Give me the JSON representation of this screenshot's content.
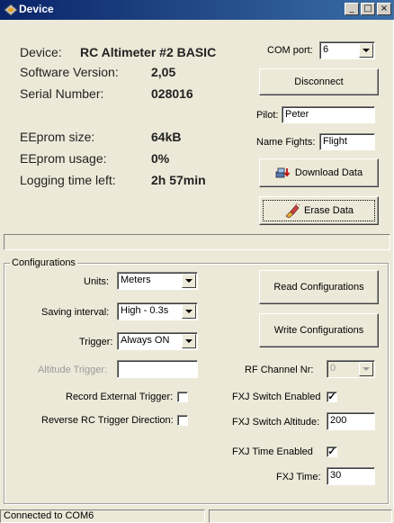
{
  "window": {
    "title": "Device",
    "min_glyph": "_",
    "max_glyph": "□",
    "close_glyph": "×"
  },
  "device": {
    "label": "Device:",
    "name": "RC Altimeter #2 BASIC",
    "software_label": "Software Version:",
    "software_value": "2,05",
    "serial_label": "Serial Number:",
    "serial_value": "028016",
    "eeprom_size_label": "EEprom size:",
    "eeprom_size_value": "64kB",
    "eeprom_usage_label": "EEprom usage:",
    "eeprom_usage_value": "0%",
    "logging_label": "Logging time left:",
    "logging_value": "2h  57min"
  },
  "right_panel": {
    "com_label": "COM port:",
    "com_value": "6",
    "disconnect": "Disconnect",
    "pilot_label": "Pilot:",
    "pilot_value": "Peter",
    "name_flights_label": "Name Fights:",
    "name_flights_value": "Flight",
    "download": "Download Data",
    "erase": "Erase Data"
  },
  "config": {
    "group_label": "Configurations",
    "units_label": "Units:",
    "units_value": "Meters",
    "saving_label": "Saving interval:",
    "saving_value": "High - 0.3s",
    "trigger_label": "Trigger:",
    "trigger_value": "Always ON",
    "alt_trigger_label": "Altitude Trigger:",
    "alt_trigger_value": "",
    "record_ext_label": "Record External Trigger:",
    "reverse_rc_label": "Reverse RC Trigger Direction:",
    "read_btn": "Read Configurations",
    "write_btn": "Write Configurations",
    "rf_label": "RF Channel Nr:",
    "rf_value": "0",
    "fxj_switch_label": "FXJ Switch Enabled",
    "fxj_switch_alt_label": "FXJ Switch Altitude:",
    "fxj_switch_alt_value": "200",
    "fxj_time_enabled_label": "FXJ Time Enabled",
    "fxj_time_label": "FXJ Time:",
    "fxj_time_value": "30",
    "check_mark": "✓"
  },
  "status": {
    "left": "Connected to COM6",
    "right": ""
  }
}
